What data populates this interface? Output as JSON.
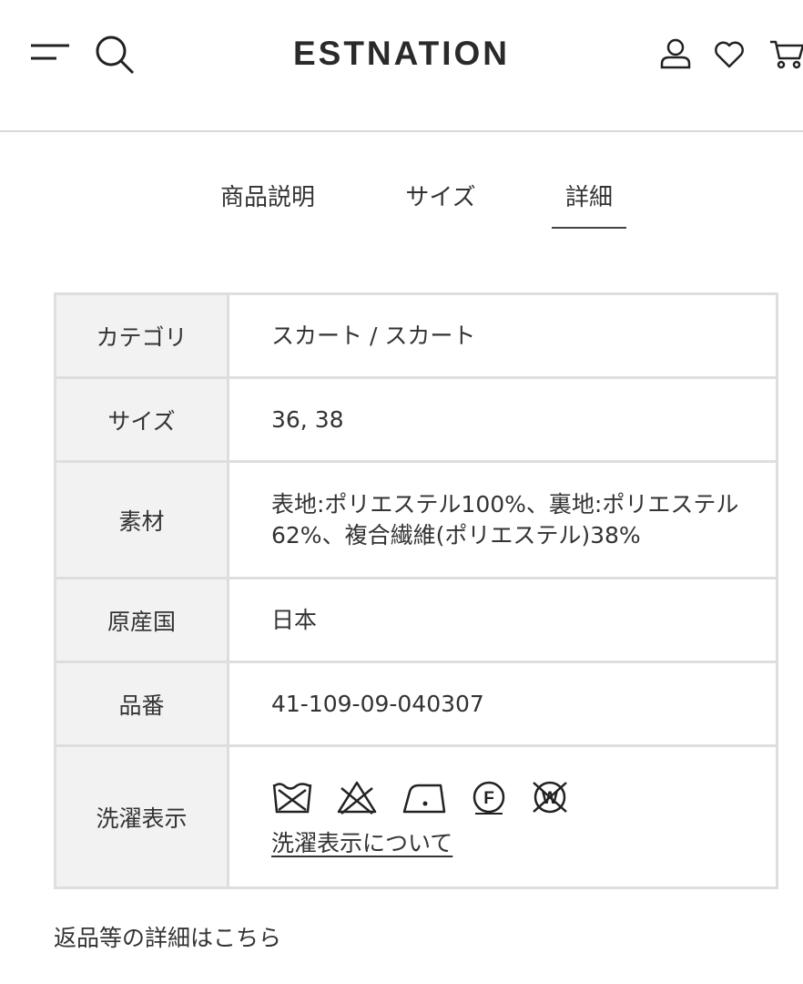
{
  "header": {
    "logo": "ESTNATION",
    "icons": [
      "menu-icon",
      "search-icon",
      "account-icon",
      "wishlist-heart-icon",
      "cart-icon"
    ]
  },
  "tabs": [
    {
      "label": "商品説明",
      "active": false
    },
    {
      "label": "サイズ",
      "active": false
    },
    {
      "label": "詳細",
      "active": true
    }
  ],
  "details": {
    "category_label": "カテゴリ",
    "category_value": "スカート / スカート",
    "size_label": "サイズ",
    "size_value": "36, 38",
    "material_label": "素材",
    "material_value": "表地:ポリエステル100%、裏地:ポリエステル62%、複合繊維(ポリエステル)38%",
    "origin_label": "原産国",
    "origin_value": "日本",
    "product_number_label": "品番",
    "product_number_value": "41-109-09-040307",
    "care_label": "洗濯表示",
    "care_icons": [
      "no-wash-icon",
      "no-bleach-icon",
      "iron-low-icon",
      "dry-clean-f-icon",
      "no-wet-clean-icon"
    ],
    "care_link": "洗濯表示について"
  },
  "returns_link": "返品等の詳細はこちら",
  "colors": {
    "text": "#333333",
    "border": "#dedede",
    "label_bg": "#f2f2f2",
    "divider": "#d9d9d9"
  }
}
